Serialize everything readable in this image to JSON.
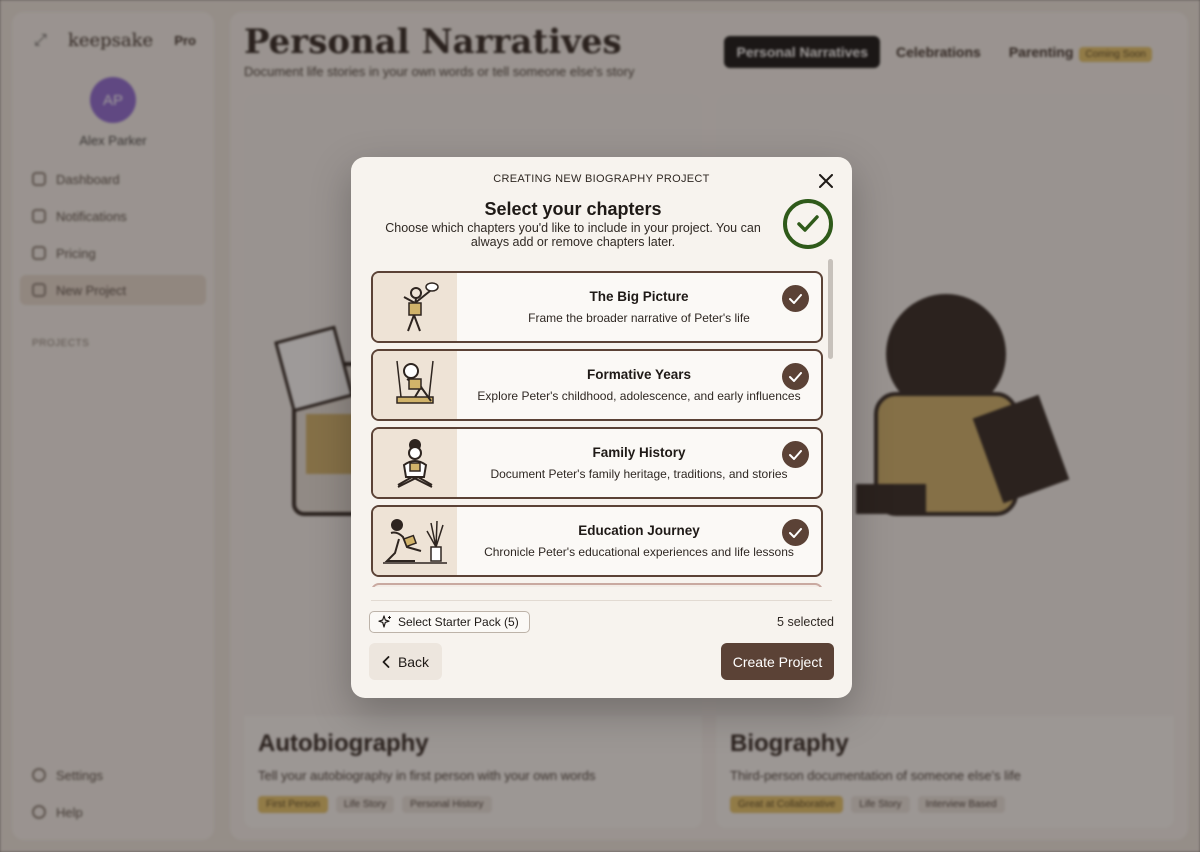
{
  "sidebar": {
    "logo": "keepsake",
    "pro_label": "Pro",
    "avatar_initials": "AP",
    "user_name": "Alex Parker",
    "nav": [
      {
        "label": "Dashboard"
      },
      {
        "label": "Notifications"
      },
      {
        "label": "Pricing"
      },
      {
        "label": "New Project"
      }
    ],
    "projects_label": "PROJECTS",
    "bottom": [
      {
        "label": "Settings"
      },
      {
        "label": "Help"
      }
    ]
  },
  "main": {
    "title": "Personal Narratives",
    "subtitle": "Document life stories in your own words or tell someone else's story",
    "tabs": [
      {
        "label": "Personal Narratives"
      },
      {
        "label": "Celebrations"
      },
      {
        "label": "Parenting"
      }
    ],
    "coming_soon": "Coming Soon",
    "cards": [
      {
        "title": "Autobiography",
        "subtitle": "Tell your autobiography in first person with your own words",
        "tags": [
          "First Person",
          "Life Story",
          "Personal History"
        ]
      },
      {
        "title": "Biography",
        "subtitle": "Third-person documentation of someone else's life",
        "tags": [
          "Great at Collaborative",
          "Life Story",
          "Interview Based"
        ]
      }
    ]
  },
  "modal": {
    "kicker": "CREATING NEW BIOGRAPHY PROJECT",
    "title": "Select your chapters",
    "description": "Choose which chapters you'd like to include in your project. You can always add or remove chapters later.",
    "chapters": [
      {
        "title": "The Big Picture",
        "description": "Frame the broader narrative of Peter's life",
        "selected": true
      },
      {
        "title": "Formative Years",
        "description": "Explore Peter's childhood, adolescence, and early influences",
        "selected": true
      },
      {
        "title": "Family History",
        "description": "Document Peter's family heritage, traditions, and stories",
        "selected": true
      },
      {
        "title": "Education Journey",
        "description": "Chronicle Peter's educational experiences and life lessons",
        "selected": true
      }
    ],
    "starter_pack_label": "Select Starter Pack (5)",
    "selected_count": "5 selected",
    "back_label": "Back",
    "create_label": "Create Project"
  },
  "colors": {
    "accent_brown": "#5b4236",
    "check_green": "#2f5a1a",
    "modal_bg": "#f7f3ee"
  },
  "icons": {
    "close": "close-icon",
    "check": "check-icon",
    "sparkle": "sparkle-icon",
    "back": "chevron-left-icon"
  }
}
